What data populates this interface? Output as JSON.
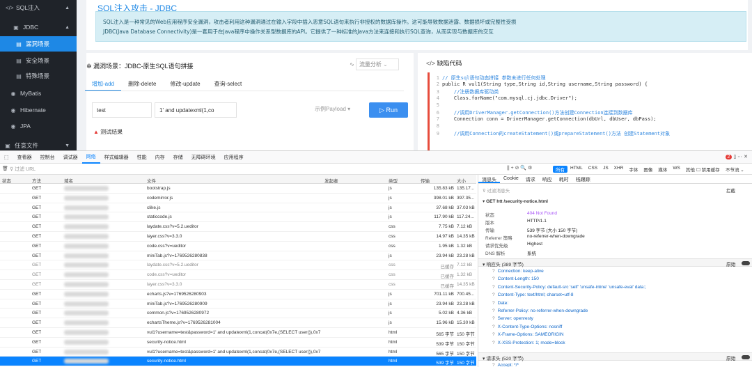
{
  "sidebar": {
    "items": [
      {
        "label": "SQL注入",
        "icon": "</>"
      },
      {
        "label": "JDBC",
        "icon": "▣"
      },
      {
        "label": "漏洞场景",
        "icon": "▤"
      },
      {
        "label": "安全场景",
        "icon": "▤"
      },
      {
        "label": "特殊场景",
        "icon": "▤"
      },
      {
        "label": "MyBatis",
        "icon": "◉"
      },
      {
        "label": "Hibernate",
        "icon": "◉"
      },
      {
        "label": "JPA",
        "icon": "◉"
      },
      {
        "label": "任意文件",
        "icon": "▣"
      }
    ]
  },
  "page": {
    "title": "SQL注入攻击 - JDBC",
    "intro_line1": "SQL注入是一种常见的Web应用程序安全漏洞，攻击者利用这种漏洞通过在输入字段中插入恶意SQL语句来执行非授权的数据库操作。这可能导致数据泄露、数据损坏或完整性受损",
    "intro_line2": "JDBC(Java Database Connectivity)是一套用于在Java程序中操作关系型数据库的API。它提供了一种标准的Java方法来连接和执行SQL查询，从而实现与数据库的交互"
  },
  "scene": {
    "label": "漏洞场景：JDBC-原生SQL语句拼接",
    "flow": "流量分析",
    "tabs": [
      "增加-add",
      "删除-delete",
      "修改-update",
      "查询-select"
    ],
    "input1": "test",
    "input2": "1' and updatexml(1,co",
    "payload": "示例Payload",
    "run": "Run",
    "result": "测试结果"
  },
  "code": {
    "title": "缺陷代码",
    "lines": [
      {
        "n": "1",
        "text": "// 原生sql语句动态拼接 参数未进行任何处理"
      },
      {
        "n": "2",
        "text": "public R vul1(String type,String id,String username,String password) {"
      },
      {
        "n": "3",
        "text": "    //注册数据库驱动类"
      },
      {
        "n": "4",
        "text": "    Class.forName(\"com.mysql.cj.jdbc.Driver\");"
      },
      {
        "n": "5",
        "text": ""
      },
      {
        "n": "6",
        "text": "    //调用DriverManager.getConnection()方法创建Connection连接到数据库"
      },
      {
        "n": "7",
        "text": "    Connection conn = DriverManager.getConnection(dbUrl, dbUser, dbPass);"
      },
      {
        "n": "8",
        "text": ""
      },
      {
        "n": "9",
        "text": "    //调用Connection的createStatement()或prepareStatement()方法 创建Statement对象"
      }
    ]
  },
  "devtools": {
    "tabs": [
      "查看器",
      "控制台",
      "调试器",
      "网络",
      "样式编辑器",
      "性能",
      "内存",
      "存储",
      "无障碍环境",
      "应用程序"
    ],
    "active_tab": "网络",
    "error_count": "2",
    "filter_placeholder": "过滤 URL",
    "filter_types": [
      "所有",
      "HTML",
      "CSS",
      "JS",
      "XHR",
      "字体",
      "图像",
      "媒体",
      "WS",
      "其他"
    ],
    "disable_cache": "禁用缓存",
    "throttle": "不节流",
    "columns": [
      "状态",
      "方法",
      "域名",
      "文件",
      "发起者",
      "类型",
      "传输",
      "大小"
    ],
    "rows": [
      {
        "status": "200",
        "method": "GET",
        "file": "bootstrap.js",
        "initiator": "script",
        "type": "js",
        "transfer": "135.83 kB",
        "size": "135.17..."
      },
      {
        "status": "200",
        "method": "GET",
        "file": "codemirror.js",
        "initiator": "script",
        "type": "js",
        "transfer": "398.01 kB",
        "size": "397.35..."
      },
      {
        "status": "200",
        "method": "GET",
        "file": "clike.js",
        "initiator": "script",
        "type": "js",
        "transfer": "37.68 kB",
        "size": "37.03 kB"
      },
      {
        "status": "200",
        "method": "GET",
        "file": "staticcode.js",
        "initiator": "script",
        "type": "js",
        "transfer": "117.90 kB",
        "size": "117.24..."
      },
      {
        "status": "200",
        "method": "GET",
        "file": "laydate.css?v=5.2.ueditor",
        "initiator": "layui.js:2",
        "init_suffix": "(stylesheet)",
        "type": "css",
        "transfer": "7.75 kB",
        "size": "7.12 kB"
      },
      {
        "status": "200",
        "method": "GET",
        "file": "layer.css?v=3.3.0",
        "initiator": "layui.js:2",
        "init_suffix": "(stylesheet)",
        "type": "css",
        "transfer": "14.97 kB",
        "size": "14.35 kB"
      },
      {
        "status": "200",
        "method": "GET",
        "file": "code.css?v=ueditor",
        "initiator": "layui.js:2",
        "init_suffix": "(stylesheet)",
        "type": "css",
        "transfer": "1.95 kB",
        "size": "1.32 kB"
      },
      {
        "status": "200",
        "method": "GET",
        "file": "miniTab.js?v=1769526280838",
        "initiator": "layui.js:2",
        "init_suffix": "(script)",
        "type": "js",
        "transfer": "23.94 kB",
        "size": "23.28 kB"
      },
      {
        "status": "200",
        "method": "GET",
        "file": "laydate.css?v=5.2.ueditor",
        "initiator": "stylesheet",
        "type": "css",
        "transfer": "已缓存",
        "size": "7.12 kB",
        "cached": true
      },
      {
        "status": "200",
        "method": "GET",
        "file": "code.css?v=ueditor",
        "initiator": "stylesheet",
        "type": "css",
        "transfer": "已缓存",
        "size": "1.32 kB",
        "cached": true
      },
      {
        "status": "200",
        "method": "GET",
        "file": "layer.css?v=3.3.0",
        "initiator": "stylesheet",
        "type": "css",
        "transfer": "已缓存",
        "size": "14.35 kB",
        "cached": true
      },
      {
        "status": "200",
        "method": "GET",
        "file": "echarts.js?v=1769526280903",
        "initiator": "layui.js:2",
        "init_suffix": "(script)",
        "type": "js",
        "transfer": "701.11 kB",
        "size": "700.45..."
      },
      {
        "status": "200",
        "method": "GET",
        "file": "miniTab.js?v=1769526280909",
        "initiator": "layui.js:2",
        "init_suffix": "(script)",
        "type": "js",
        "transfer": "23.94 kB",
        "size": "23.28 kB"
      },
      {
        "status": "200",
        "method": "GET",
        "file": "common.js?v=1769526280972",
        "initiator": "layui.js:2",
        "init_suffix": "(script)",
        "type": "js",
        "transfer": "5.02 kB",
        "size": "4.36 kB"
      },
      {
        "status": "200",
        "method": "GET",
        "file": "echartsTheme.js?v=1769526281004",
        "initiator": "layui.js:2",
        "init_suffix": "(script)",
        "type": "js",
        "transfer": "15.96 kB",
        "size": "15.30 kB"
      },
      {
        "status": "302",
        "method": "GET",
        "file": "vul1?username=test&password=1' and updatexml(1,concat(0x7e,(SELECT user()),0x7",
        "initiator": "jquery-3.4.1.min.js:2",
        "init_suffix": "(xhr)",
        "type": "html",
        "transfer": "565 字节",
        "size": "150 字节"
      },
      {
        "status": "404",
        "method": "GET",
        "file": "security-notice.html",
        "initiator": "jquery-3.4.1.min.js:2",
        "init_suffix": "(xhr)",
        "type": "html",
        "transfer": "539 字节",
        "size": "150 字节"
      },
      {
        "status": "302",
        "method": "GET",
        "file": "vul1?username=test&password=1' and updatexml(1,concat(0x7e,(SELECT user()),0x7",
        "initiator": "jquery-3.4.1.min.js:2",
        "init_suffix": "(xhr)",
        "type": "html",
        "transfer": "565 字节",
        "size": "150 字节"
      },
      {
        "status": "404",
        "method": "GET",
        "file": "security-notice.html",
        "initiator": "jquery-3.4.1.min.js:2",
        "init_suffix": "(xhr)",
        "type": "html",
        "transfer": "539 字节",
        "size": "150 字节",
        "selected": true
      }
    ],
    "details": {
      "tabs": [
        "消息头",
        "Cookie",
        "请求",
        "响应",
        "耗时",
        "栈跟踪"
      ],
      "filter_placeholder": "过滤消息头",
      "block": "拦截",
      "resend": "重新发送",
      "request_line": "GET  htt                 /security-notice.html",
      "summary": [
        {
          "k": "状态",
          "v": "404 Not Found"
        },
        {
          "k": "版本",
          "v": "HTTP/1.1"
        },
        {
          "k": "传输",
          "v": "539 字节 (大小 150 字节)"
        },
        {
          "k": "Referrer 策略",
          "v": "no-referrer-when-downgrade"
        },
        {
          "k": "请求优先级",
          "v": "Highest"
        },
        {
          "k": "DNS 解析",
          "v": "系统"
        }
      ],
      "response_header_title": "响应头 (389 字节)",
      "raw_label": "原始",
      "response_headers": [
        "Connection: keep-alive",
        "Content-Length: 150",
        "Content-Security-Policy: default-src 'self' 'unsafe-inline' 'unsafe-eval' data:;",
        "Content-Type: text/html; charset=utf-8",
        "Date: ",
        "Referrer-Policy: no-referrer-when-downgrade",
        "Server: openresty",
        "X-Content-Type-Options: nosniff",
        "X-Frame-Options: SAMEORIGIN",
        "X-XSS-Protection: 1; mode=block"
      ],
      "request_header_title": "请求头 (520 字节)",
      "request_headers": [
        "Accept: */*",
        "Accept-Encoding: gzip, deflate"
      ]
    }
  }
}
